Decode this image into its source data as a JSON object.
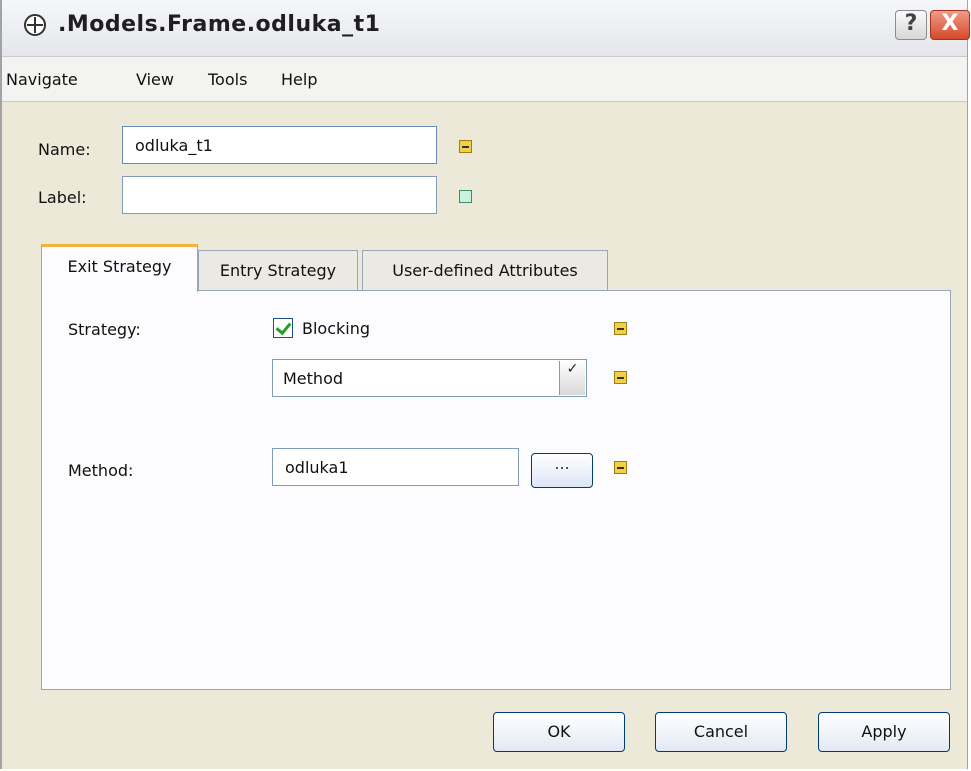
{
  "window": {
    "title": ".Models.Frame.odluka_t1",
    "help_label": "?",
    "close_label": "X"
  },
  "menu": {
    "items": [
      "Navigate",
      "View",
      "Tools",
      "Help"
    ]
  },
  "form": {
    "name_label": "Name:",
    "name_value": "odluka_t1",
    "label_label": "Label:",
    "label_value": ""
  },
  "tabs": [
    {
      "label": "Exit Strategy",
      "active": true
    },
    {
      "label": "Entry Strategy",
      "active": false
    },
    {
      "label": "User-defined Attributes",
      "active": false
    }
  ],
  "exit_strategy": {
    "strategy_label": "Strategy:",
    "blocking_label": "Blocking",
    "blocking_checked": true,
    "strategy_select_value": "Method",
    "method_label": "Method:",
    "method_value": "odluka1",
    "browse_label": "..."
  },
  "buttons": {
    "ok": "OK",
    "cancel": "Cancel",
    "apply": "Apply"
  },
  "colors": {
    "marker_yellow": "#f2cf43",
    "marker_green": "#c8f1df",
    "active_tab_accent": "#f2b33f",
    "close_button": "#d5492b"
  }
}
